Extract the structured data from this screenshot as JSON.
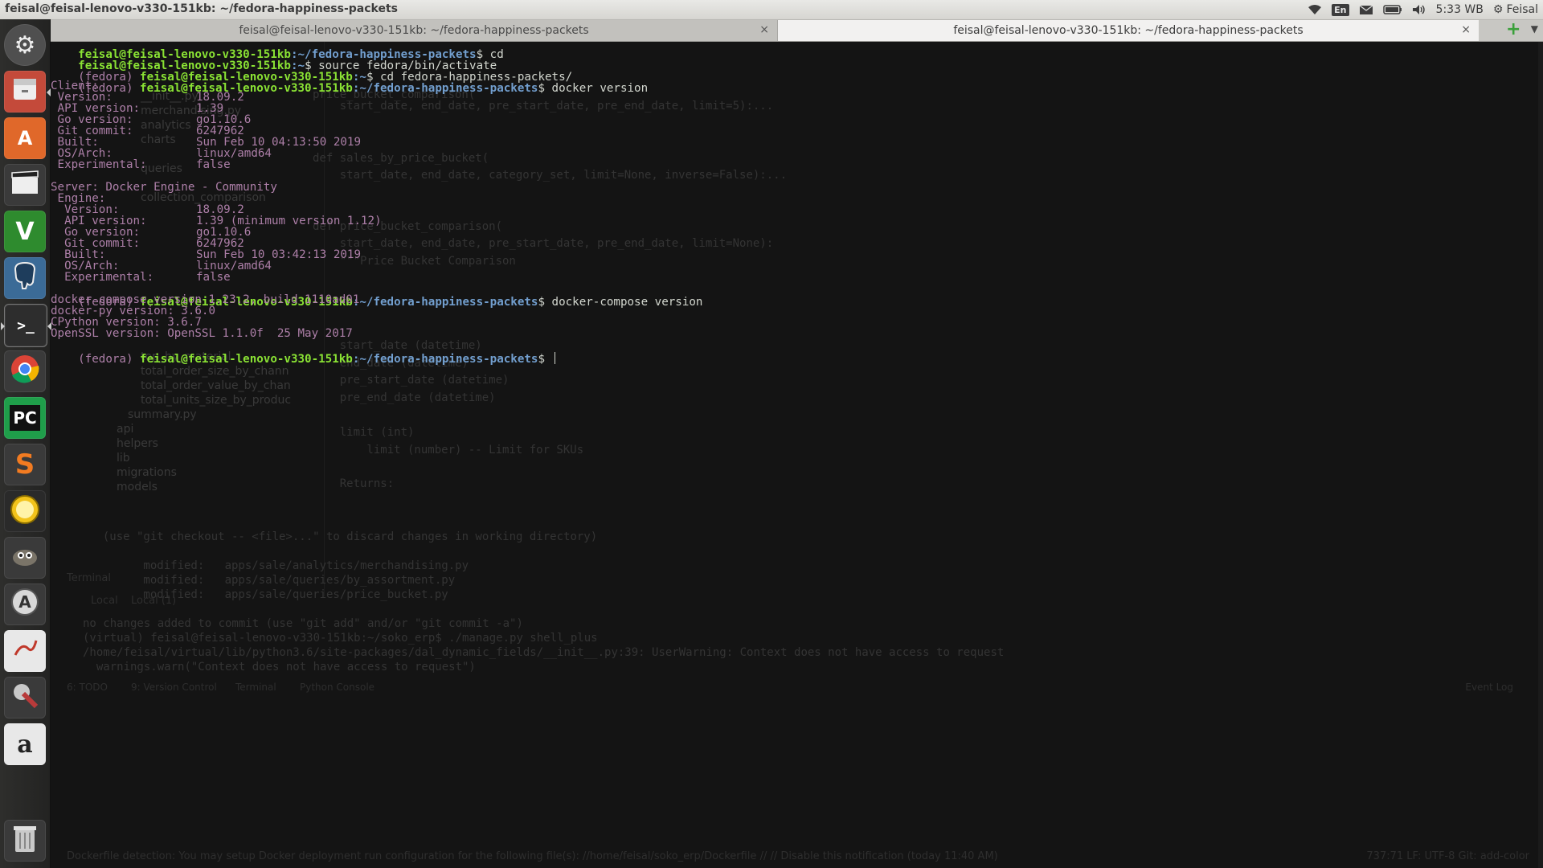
{
  "topbar": {
    "window_title": "feisal@feisal-lenovo-v330-151kb: ~/fedora-happiness-packets",
    "keyboard_layout": "En",
    "clock": "5:33 WB",
    "user": "Feisal"
  },
  "launcher": {
    "items": [
      {
        "name": "dash-home",
        "icon": "gear-icon",
        "color": "#4f4f4f"
      },
      {
        "name": "files",
        "icon": "file-cabinet-icon",
        "color": "#c44a3a"
      },
      {
        "name": "software-center",
        "icon": "shopping-bag-icon",
        "color": "#e0682a"
      },
      {
        "name": "video-editor",
        "icon": "clapperboard-icon",
        "color": "#3a3a3a"
      },
      {
        "name": "vim",
        "icon": "vim-icon",
        "color": "#2e8b2e"
      },
      {
        "name": "pgadmin",
        "icon": "elephant-icon",
        "color": "#3b6b97"
      },
      {
        "name": "terminal",
        "icon": "terminal-icon",
        "color": "#2d2d2d"
      },
      {
        "name": "chrome",
        "icon": "chrome-icon",
        "color": "#d8d8d8"
      },
      {
        "name": "pycharm",
        "icon": "pycharm-icon",
        "color": "#1f9e4a"
      },
      {
        "name": "sublime-text",
        "icon": "sublime-icon",
        "color": "#f27b21"
      },
      {
        "name": "stopwatch",
        "icon": "stopwatch-icon",
        "color": "#f2c31a"
      },
      {
        "name": "gimp",
        "icon": "gimp-icon",
        "color": "#5c5a52"
      },
      {
        "name": "software-updater",
        "icon": "updater-icon",
        "color": "#cfcfcf"
      },
      {
        "name": "text-editor",
        "icon": "pen-icon",
        "color": "#e8e8e8"
      },
      {
        "name": "system-settings",
        "icon": "wrench-icon",
        "color": "#9a3a3a"
      },
      {
        "name": "amazon",
        "icon": "amazon-icon",
        "color": "#e8e8e8"
      },
      {
        "name": "trash",
        "icon": "trash-icon",
        "color": "#bfbfbf"
      }
    ]
  },
  "tabs": [
    {
      "title": "feisal@feisal-lenovo-v330-151kb: ~/fedora-happiness-packets",
      "close": "×"
    },
    {
      "title": "feisal@feisal-lenovo-v330-151kb: ~/fedora-happiness-packets",
      "close": "×"
    }
  ],
  "terminal": {
    "user_host": "feisal@feisal-lenovo-v330-151kb",
    "lines": [
      {
        "venv": "",
        "path": ":~/fedora-happiness-packets",
        "cmd": "$ cd"
      },
      {
        "venv": "",
        "path": ":~",
        "cmd": "$ source fedora/bin/activate"
      },
      {
        "venv": "(fedora) ",
        "path": ":~",
        "cmd": "$ cd fedora-happiness-packets/"
      },
      {
        "venv": "(fedora) ",
        "path": ":~/fedora-happiness-packets",
        "cmd": "$ docker version"
      }
    ],
    "client_header": "Client:",
    "client": [
      {
        "key": " Version:",
        "value": "18.09.2"
      },
      {
        "key": " API version:",
        "value": "1.39"
      },
      {
        "key": " Go version:",
        "value": "go1.10.6"
      },
      {
        "key": " Git commit:",
        "value": "6247962"
      },
      {
        "key": " Built:",
        "value": "Sun Feb 10 04:13:50 2019"
      },
      {
        "key": " OS/Arch:",
        "value": "linux/amd64"
      },
      {
        "key": " Experimental:",
        "value": "false"
      }
    ],
    "server_header": "Server: Docker Engine - Community",
    "engine_header": " Engine:",
    "server": [
      {
        "key": "  Version:",
        "value": "18.09.2"
      },
      {
        "key": "  API version:",
        "value": "1.39 (minimum version 1.12)"
      },
      {
        "key": "  Go version:",
        "value": "go1.10.6"
      },
      {
        "key": "  Git commit:",
        "value": "6247962"
      },
      {
        "key": "  Built:",
        "value": "Sun Feb 10 03:42:13 2019"
      },
      {
        "key": "  OS/Arch:",
        "value": "linux/amd64"
      },
      {
        "key": "  Experimental:",
        "value": "false"
      }
    ],
    "compose_prompt": {
      "venv": "(fedora) ",
      "path": ":~/fedora-happiness-packets",
      "cmd": "$ docker-compose version"
    },
    "compose_output": [
      "docker-compose version 1.23.2, build 1110ad01",
      "docker-py version: 3.6.0",
      "CPython version: 3.6.7",
      "OpenSSL version: OpenSSL 1.1.0f  25 May 2017"
    ],
    "final_prompt": {
      "venv": "(fedora) ",
      "path": ":~/fedora-happiness-packets",
      "cmd": "$ "
    }
  },
  "background_ide": {
    "tree_items": [
      "__init__.py",
      "merchandising.py",
      "analytics",
      "charts",
      "queries",
      "collection_comparison",
      "summary.py",
      "api",
      "helpers",
      "lib",
      "migrations",
      "models",
      "top_by_material",
      "total_order_size_by_chann",
      "total_order_value_by_chan",
      "total_units_size_by_produc"
    ],
    "code_lines": [
      "price_bucket_comparison(",
      "    start_date, end_date, pre_start_date, pre_end_date, limit=5):...",
      "def sales_by_price_bucket(",
      "    start_date, end_date, category_set, limit=None, inverse=False):...",
      "def price_bucket_comparison(",
      "    start_date, end_date, pre_start_date, pre_end_date, limit=None):",
      "    \"\"\"Price Bucket Comparison",
      "    start_date (datetime)",
      "    end_date (datetime)",
      "    pre_start_date (datetime)",
      "    pre_end_date (datetime)",
      "    limit (int)",
      "        limit (number) -- Limit for SKUs",
      "    Returns:"
    ],
    "terminal_tabs": [
      "Terminal",
      "Local",
      "Local (1)"
    ],
    "term_lines": [
      "  (use \"git checkout -- <file>...\" to discard changes in working directory)",
      "        modified:   apps/sale/analytics/merchandising.py",
      "        modified:   apps/sale/queries/by_assortment.py",
      "        modified:   apps/sale/queries/price_bucket.py",
      "no changes added to commit (use \"git add\" and/or \"git commit -a\")",
      "(virtual) feisal@feisal-lenovo-v330-151kb:~/soko_erp$ ./manage.py shell_plus",
      "/home/feisal/virtual/lib/python3.6/site-packages/dal_dynamic_fields/__init__.py:39: UserWarning: Context does not have access to request",
      "  warnings.warn(\"Context does not have access to request\")"
    ],
    "bottom_tabs": [
      "6: TODO",
      "9: Version Control",
      "Terminal",
      "Python Console",
      "Event Log"
    ],
    "status_text": "Dockerfile detection: You may setup Docker deployment run configuration for the following file(s): //home/feisal/soko_erp/Dockerfile // // Disable this notification (today 11:40 AM)",
    "status_right": "737:71  LF:  UTF-8  Git: add-color"
  }
}
